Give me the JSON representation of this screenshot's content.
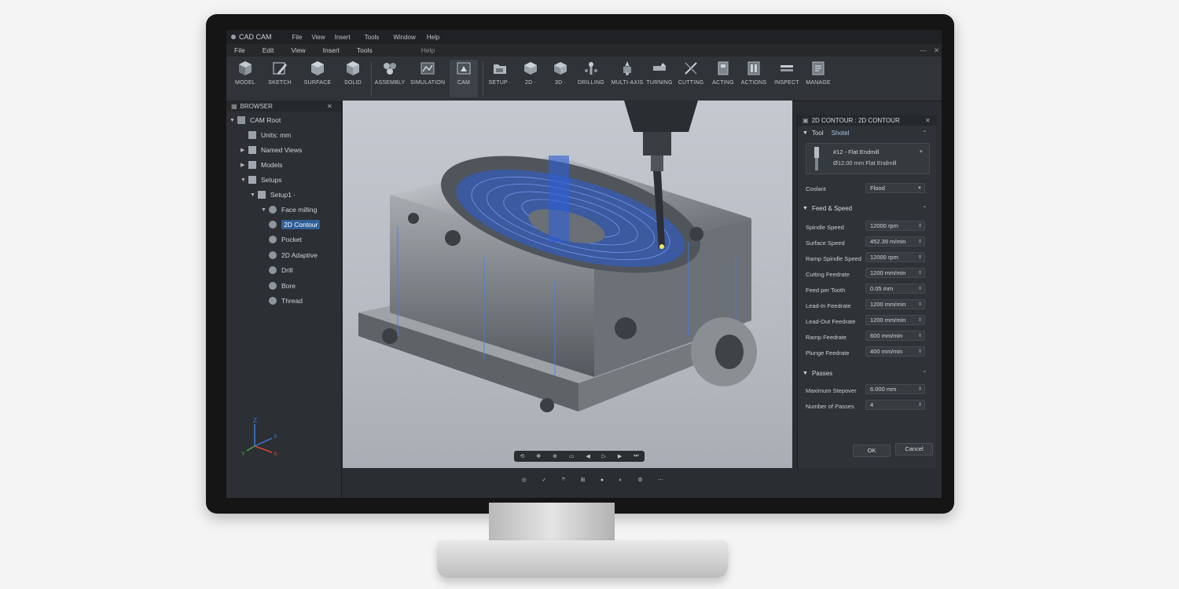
{
  "window": {
    "app_title": "CAD CAM",
    "title_menu": [
      "File",
      "View",
      "Insert",
      "Tools",
      "Window",
      "Help"
    ]
  },
  "menu": [
    "File",
    "Edit",
    "View",
    "Insert",
    "Tools",
    "Help"
  ],
  "ribbon": {
    "items": [
      "MODEL",
      "SKETCH",
      "SURFACE",
      "SOLID",
      "ASSEMBLY",
      "SIMULATION",
      "CAM",
      "SETUP ·",
      "2D ·",
      "3D ·",
      "DRILLING",
      "MULTI-AXIS",
      "TURNING",
      "CUTTING",
      "ACTING",
      "ACTIONS",
      "INSPECT",
      "MANAGE"
    ],
    "active": "CAM"
  },
  "browser": {
    "title": "BROWSER",
    "items": [
      "CAM Root",
      "Units: mm",
      "Named Views",
      "Models",
      "Setups",
      "Setup1 ·",
      "Face milling",
      "2D Contour",
      "Pocket",
      "2D Adaptive",
      "Drill",
      "Bore",
      "Thread"
    ],
    "selected": "2D Contour"
  },
  "viewport": {
    "triad": {
      "z": "Z",
      "x": "X",
      "y": "Y",
      "x2": "X"
    }
  },
  "panel": {
    "title": "2D CONTOUR : 2D CONTOUR",
    "tool": {
      "section": "Tool",
      "tab": "Shotel",
      "name": "#12 - Flat Endmill",
      "desc": "Ø12.00 mm Flat Endmill",
      "coolant_label": "Coolant",
      "coolant_value": "Flood"
    },
    "feed": {
      "section": "Feed & Speed",
      "rows": [
        {
          "label": "Spindle Speed",
          "value": "12000 rpm"
        },
        {
          "label": "Surface Speed",
          "value": "452.39 m/min"
        },
        {
          "label": "Ramp Spindle Speed",
          "value": "12000 rpm"
        },
        {
          "label": "Cutting Feedrate",
          "value": "1200 mm/min"
        },
        {
          "label": "Feed per Tooth",
          "value": "0.05 mm"
        },
        {
          "label": "Lead-In Feedrate",
          "value": "1200 mm/min"
        },
        {
          "label": "Lead-Out Feedrate",
          "value": "1200 mm/min"
        },
        {
          "label": "Ramp Feedrate",
          "value": "600 mm/min"
        },
        {
          "label": "Plunge Feedrate",
          "value": "400 mm/min"
        }
      ]
    },
    "passes": {
      "section": "Passes",
      "rows": [
        {
          "label": "Maximum Stepover",
          "value": "6.000 mm"
        },
        {
          "label": "Number of Passes",
          "value": "4"
        }
      ]
    },
    "ok": "OK",
    "cancel": "Cancel"
  },
  "colors": {
    "accent": "#2f5f96",
    "toolpath": "#2e5fd8",
    "background": "#2a2d31"
  }
}
